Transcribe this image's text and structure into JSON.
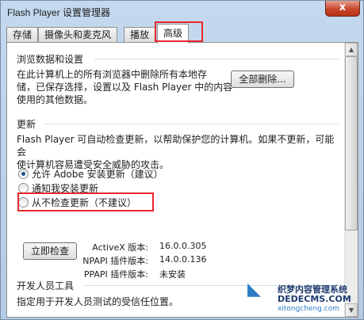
{
  "window": {
    "title": "Flash Player 设置管理器",
    "close_label": "x"
  },
  "tabs": [
    {
      "label": "存储",
      "active": false
    },
    {
      "label": "摄像头和麦克风",
      "active": false
    },
    {
      "label": "播放",
      "active": false
    },
    {
      "label": "高级",
      "active": true
    }
  ],
  "browsing": {
    "title": "浏览数据和设置",
    "description_lines": [
      "在此计算机上的所有浏览器中删除所有本地存",
      "储，已保存选择，设置以及 Flash Player 中的内容",
      "使用的其他数据。"
    ],
    "delete_all_label": "全部删除..."
  },
  "updates": {
    "title": "更新",
    "description_lines": [
      "Flash Player 可自动检查更新，以帮助保护您的计算机。如果不更新，可能会",
      "使计算机容易遭受安全威胁的攻击。"
    ],
    "options": [
      {
        "label": "允许 Adobe 安装更新（建议）",
        "selected": true
      },
      {
        "label": "通知我安装更新",
        "selected": false
      },
      {
        "label": "从不检查更新（不建议）",
        "selected": false
      }
    ],
    "check_now_label": "立即检查",
    "versions": [
      {
        "label": "ActiveX 版本:",
        "value": "16.0.0.305"
      },
      {
        "label": "NPAPI 插件版本:",
        "value": "14.0.0.136"
      },
      {
        "label": "PPAPI 插件版本:",
        "value": "未安装"
      }
    ]
  },
  "developer": {
    "title": "开发人员工具",
    "description": "指定用于开发人员测试的受信任位置。"
  },
  "scrollbar": {
    "up_arrow": "▲",
    "down_arrow": "▼"
  },
  "watermark": {
    "logo": "系统城",
    "site_name": "织梦内容管理系统",
    "domain": "DEDECMS.COM",
    "sub": "xitongcheng.com"
  },
  "colors": {
    "highlight": "#e8262e",
    "accent": "#2e7dc4"
  }
}
